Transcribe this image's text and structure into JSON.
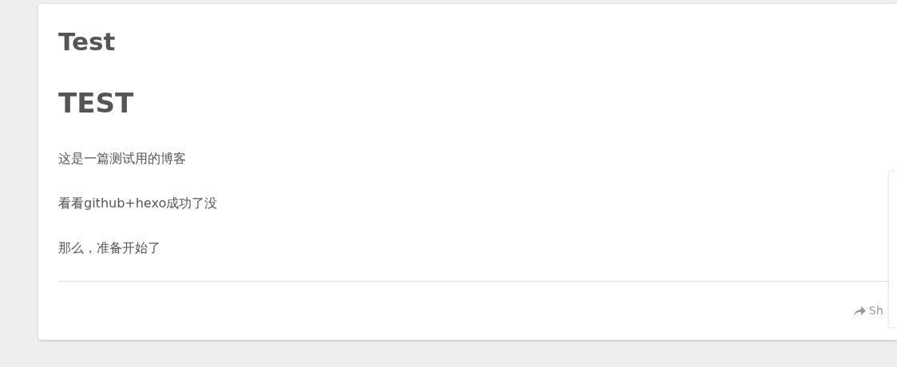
{
  "post": {
    "title": "Test",
    "heading": "TEST",
    "paragraphs": [
      "这是一篇测试用的博客",
      "看看github+hexo成功了没",
      "那么，准备开始了"
    ],
    "share_label": "Sh"
  }
}
